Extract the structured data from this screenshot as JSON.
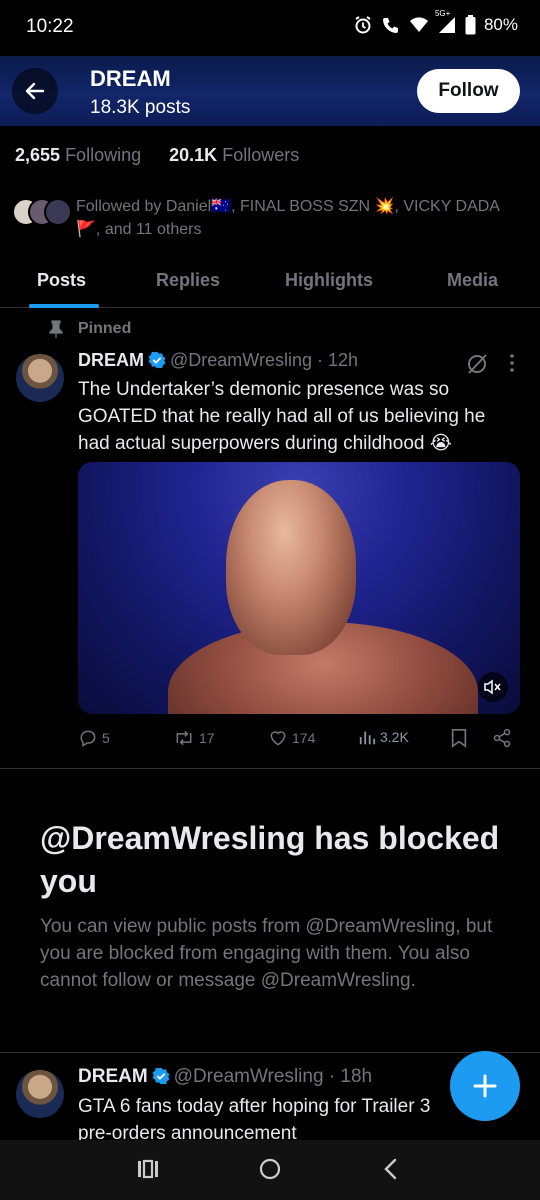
{
  "status_bar": {
    "time": "10:22",
    "network": "5G+",
    "battery": "80%"
  },
  "header": {
    "name": "DREAM",
    "posts": "18.3K posts",
    "follow_label": "Follow"
  },
  "stats": {
    "following_count": "2,655",
    "following_label": "Following",
    "followers_count": "20.1K",
    "followers_label": "Followers"
  },
  "followed_by": "Followed by Daniel🇦🇺, FINAL BOSS SZN 💥, VICKY DADA 🚩, and 11 others",
  "tabs": [
    {
      "label": "Posts",
      "active": true
    },
    {
      "label": "Replies",
      "active": false
    },
    {
      "label": "Highlights",
      "active": false
    },
    {
      "label": "Media",
      "active": false
    }
  ],
  "pinned_tweet": {
    "pinned_label": "Pinned",
    "name": "DREAM",
    "handle": "@DreamWresling",
    "time": "· 12h",
    "text": "The Undertaker’s demonic presence was so GOATED that he really had all of us believing he had actual superpowers during childhood 😭",
    "replies": "5",
    "reposts": "17",
    "likes": "174",
    "views": "3.2K"
  },
  "blocked": {
    "title": "@DreamWresling has blocked you",
    "text": "You can view public posts from @DreamWresling, but you are blocked from engaging with them. You also cannot follow or message @DreamWresling."
  },
  "tweet2": {
    "name": "DREAM",
    "handle": "@DreamWresling",
    "time": "· 18h",
    "text": "GTA 6 fans today after hoping for Trailer 3 pre-orders announcement"
  },
  "colors": {
    "accent": "#1d9bf0",
    "muted": "#71767b",
    "background": "#000000"
  }
}
